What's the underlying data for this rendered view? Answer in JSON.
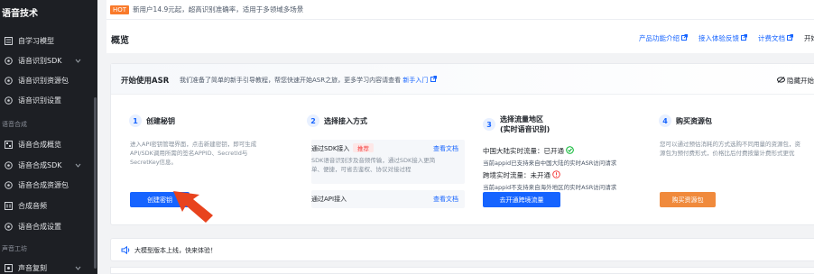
{
  "sidebar": {
    "title": "语音技术",
    "items": [
      {
        "label": "自学习模型",
        "icon": "model-icon",
        "chevron": false
      },
      {
        "label": "语音识别SDK",
        "icon": "sdk-icon",
        "chevron": true
      },
      {
        "label": "语音识别资源包",
        "icon": "package-icon",
        "chevron": false
      },
      {
        "label": "语音识别设置",
        "icon": "settings-icon",
        "chevron": false
      }
    ],
    "section_synthesis": "语音合成",
    "synthesis_items": [
      {
        "label": "语音合成概览",
        "icon": "overview-icon",
        "chevron": false
      },
      {
        "label": "语音合成SDK",
        "icon": "sdk-icon",
        "chevron": true
      },
      {
        "label": "语音合成资源包",
        "icon": "package-icon",
        "chevron": false
      },
      {
        "label": "合成音频",
        "icon": "audio-icon",
        "chevron": false
      },
      {
        "label": "语音合成设置",
        "icon": "settings-icon",
        "chevron": false
      }
    ],
    "section_studio": "声音工坊",
    "studio_items": [
      {
        "label": "声音复刻",
        "icon": "clone-icon",
        "chevron": true
      }
    ]
  },
  "notice": {
    "badge": "HOT",
    "text": "新用户14.9元起，超高识别准确率，适用于多领域多场景"
  },
  "header": {
    "title": "概览",
    "links": [
      "产品功能介绍",
      "接入体验反馈",
      "计费文档",
      "开始使"
    ]
  },
  "guide": {
    "title": "开始使用ASR",
    "desc": "我们准备了简单的新手引导教程，帮您快速开始ASR之旅，更多学习内容请查看",
    "desc_link": "新手入门",
    "hide_label": "隐藏开始",
    "steps": [
      {
        "num": "1",
        "title": "创建秘钥",
        "text": [
          "进入API密钥管理界面，点击新建密钥，即可生成",
          "API/SDK调用所需的签名APPID、SecretId与",
          "SecretKey信息。"
        ],
        "button": "创建密钥"
      },
      {
        "num": "2",
        "title": "选择接入方式",
        "sdk_label": "通过SDK接入",
        "sdk_tag": "推荐",
        "sdk_doc": "查看文档",
        "sdk_text": [
          "SDK语音识别涉及音频传输，通过SDK接入更简",
          "单、便捷，可省去鉴权、协议对接过程"
        ],
        "api_label": "通过API接入",
        "api_doc": "查看文档"
      },
      {
        "num": "3",
        "title": "选择流量地区",
        "subtitle": "(实时语音识别)",
        "cn_label": "中国大陆实时流量：已开通",
        "cn_sub": "当前appid已支持来自中国大陆的实时ASR访问请求",
        "intl_label": "跨境实时流量：未开通",
        "intl_sub": "当前appid不支持来自海外地区的实时ASR访问请求",
        "button": "去开通跨境流量"
      },
      {
        "num": "4",
        "title": "购买资源包",
        "text": [
          "您可以通过预估消耗的方式选购不同用量的资源包，资",
          "源包为预付费形式，价格比后付费按量计费形式更优"
        ],
        "button": "购买资源包"
      }
    ]
  },
  "banner": {
    "text": "大模型版本上线，快来体验！"
  },
  "colors": {
    "sidebar_bg": "#1d1f24",
    "accent": "#1664ff",
    "orange": "#f08a3c",
    "hot": "#f97a2b",
    "arrow": "#e8431e"
  }
}
